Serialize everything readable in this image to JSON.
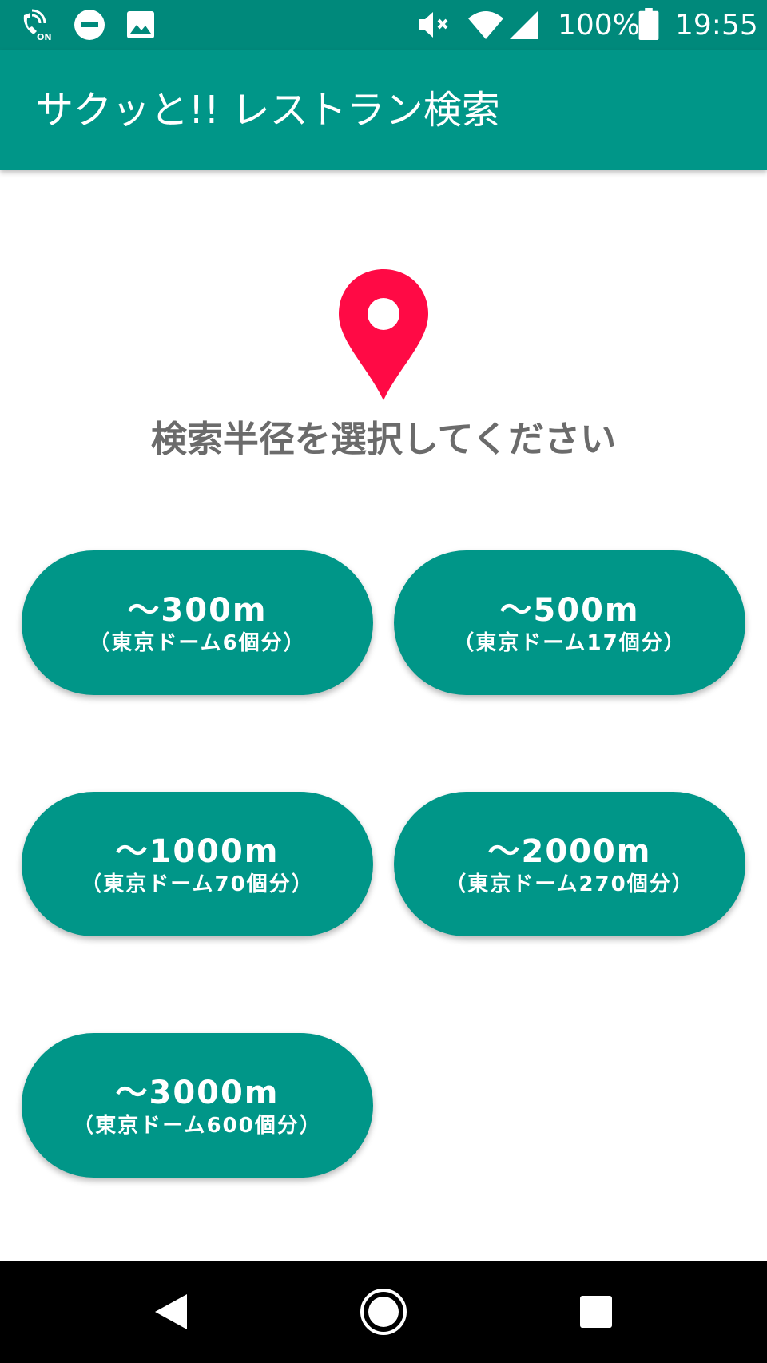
{
  "status_bar": {
    "battery_text": "100%",
    "time": "19:55",
    "icons": [
      "wifi-calling-on-icon",
      "do-not-disturb-icon",
      "image-icon",
      "mute-icon",
      "wifi-icon",
      "signal-icon",
      "battery-icon"
    ]
  },
  "app_bar": {
    "title": "サクッと!! レストラン検索"
  },
  "main": {
    "prompt": "検索半径を選択してください",
    "pin_icon": "location-pin-icon",
    "pin_color": "#ff0a45",
    "buttons": [
      {
        "range": "～300m",
        "note": "（東京ドーム6個分）"
      },
      {
        "range": "～500m",
        "note": "（東京ドーム17個分）"
      },
      {
        "range": "～1000m",
        "note": "（東京ドーム70個分）"
      },
      {
        "range": "～2000m",
        "note": "（東京ドーム270個分）"
      },
      {
        "range": "～3000m",
        "note": "（東京ドーム600個分）"
      }
    ]
  },
  "nav_bar": {
    "icons": [
      "back-icon",
      "home-icon",
      "recents-icon"
    ]
  },
  "colors": {
    "status_bar": "#00897b",
    "primary": "#009688",
    "prompt_text": "#6b6b6b"
  }
}
